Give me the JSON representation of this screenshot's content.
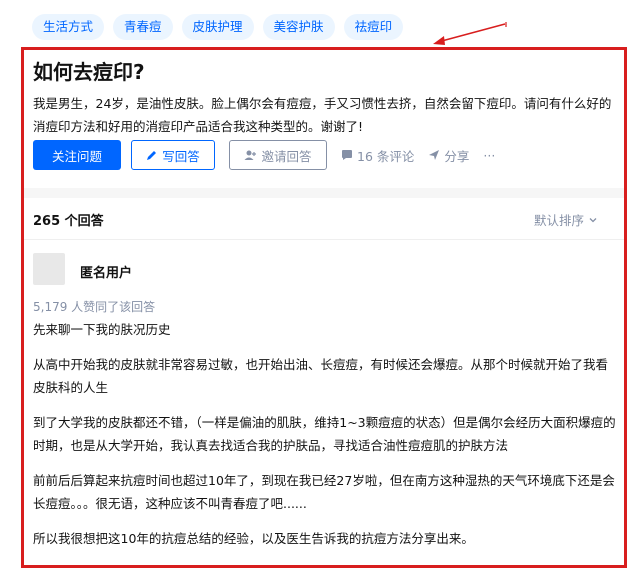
{
  "tags": [
    "生活方式",
    "青春痘",
    "皮肤护理",
    "美容护肤",
    "祛痘印"
  ],
  "question": {
    "title": "如何去痘印?",
    "detail": "我是男生，24岁，是油性皮肤。脸上偶尔会有痘痘，手又习惯性去挤，自然会留下痘印。请问有什么好的消痘印方法和好用的消痘印产品适合我这种类型的。谢谢了!"
  },
  "actions": {
    "follow": "关注问题",
    "write": "写回答",
    "invite": "邀请回答",
    "comments": "16 条评论",
    "share": "分享",
    "more": "···"
  },
  "answers": {
    "count": "265 个回答",
    "sort": "默认排序"
  },
  "answer": {
    "author": "匿名用户",
    "upvotes": "5,179 人赞同了该回答",
    "paragraphs": [
      "先来聊一下我的肤况历史",
      "从高中开始我的皮肤就非常容易过敏，也开始出油、长痘痘，有时候还会爆痘。从那个时候就开始了我看皮肤科的人生",
      "到了大学我的皮肤都还不错，（一样是偏油的肌肤，维持1~3颗痘痘的状态）但是偶尔会经历大面积爆痘的时期，也是从大学开始，我认真去找适合我的护肤品，寻找适合油性痘痘肌的护肤方法",
      "前前后后算起来抗痘时间也超过10年了，到现在我已经27岁啦，但在南方这种湿热的天气环境底下还是会长痘痘。。。很无语，这种应该不叫青春痘了吧......",
      "所以我很想把这10年的抗痘总结的经验，以及医生告诉我的抗痘方法分享出来。"
    ]
  },
  "colors": {
    "accent": "#0066ff",
    "highlight_frame": "#d81e1e",
    "muted": "#8590a6"
  }
}
